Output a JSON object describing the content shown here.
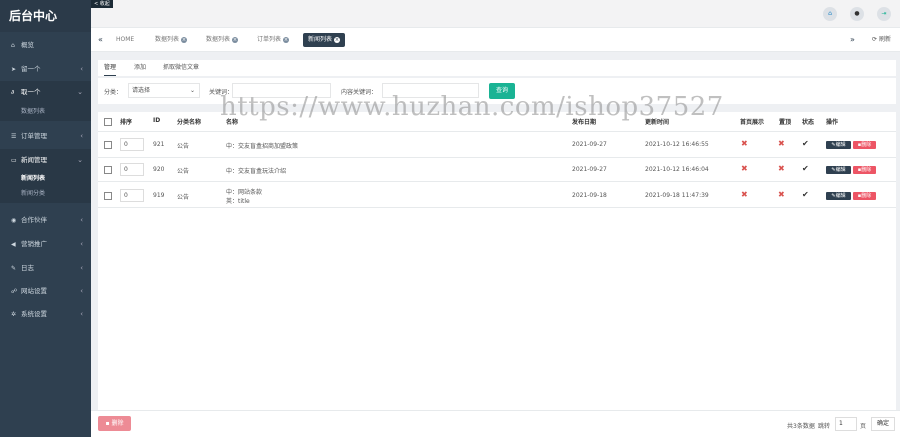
{
  "sidebar": {
    "brand": "后台中心",
    "collapse_label": "< 收起",
    "items": [
      {
        "label": "概览",
        "icon": "home-icon"
      },
      {
        "label": "留一个",
        "icon": "send-icon"
      },
      {
        "label": "取一个",
        "icon": "paperclip-icon"
      },
      {
        "label": "订单管理",
        "icon": "list-icon"
      },
      {
        "label": "新闻管理",
        "icon": "monitor-icon"
      },
      {
        "label": "合作伙伴",
        "icon": "eye-icon"
      },
      {
        "label": "营销推广",
        "icon": "bullhorn-icon"
      },
      {
        "label": "日志",
        "icon": "edit-icon"
      },
      {
        "label": "网站设置",
        "icon": "sitemap-icon"
      },
      {
        "label": "系统设置",
        "icon": "gear-icon"
      }
    ],
    "sub_items": {
      "qu": [
        "数据列表"
      ],
      "news": [
        "新闻列表",
        "新闻分类"
      ]
    }
  },
  "tabs": [
    {
      "label": "HOME"
    },
    {
      "label": "数据列表"
    },
    {
      "label": "数据列表"
    },
    {
      "label": "订单列表"
    },
    {
      "label": "新闻列表"
    }
  ],
  "refresh_label": "刷新",
  "subtabs": [
    "管理",
    "添加",
    "抓取微信文章"
  ],
  "filter": {
    "category_label": "分类：",
    "category_value": "请选择",
    "keyword_label": "关键词：",
    "content_label": "内容关键词：",
    "search_button": "查询"
  },
  "table": {
    "headers": [
      "排序",
      "ID",
      "分类名称",
      "名称",
      "发布日期",
      "更新时间",
      "首页展示",
      "置顶",
      "状态",
      "操作"
    ],
    "rows": [
      {
        "sort": "0",
        "id": "921",
        "category": "公告",
        "name": "中：交友盲盒招商加盟政策",
        "name2": "",
        "publish": "2021-09-27",
        "update": "2021-10-12 16:46:55"
      },
      {
        "sort": "0",
        "id": "920",
        "category": "公告",
        "name": "中：交友盲盒玩法介绍",
        "name2": "",
        "publish": "2021-09-27",
        "update": "2021-10-12 16:46:04"
      },
      {
        "sort": "0",
        "id": "919",
        "category": "公告",
        "name": "中：网站条款",
        "name2": "英：title",
        "publish": "2021-09-18",
        "update": "2021-09-18 11:47:39"
      }
    ],
    "edit_label": "编辑",
    "delete_label": "删除"
  },
  "footer": {
    "bulk_delete": "删除",
    "total": "共3条数据",
    "goto": "跳转",
    "page_value": "1",
    "page_unit": "页",
    "confirm": "确定"
  },
  "watermark": "https://www.huzhan.com/ishop37527"
}
